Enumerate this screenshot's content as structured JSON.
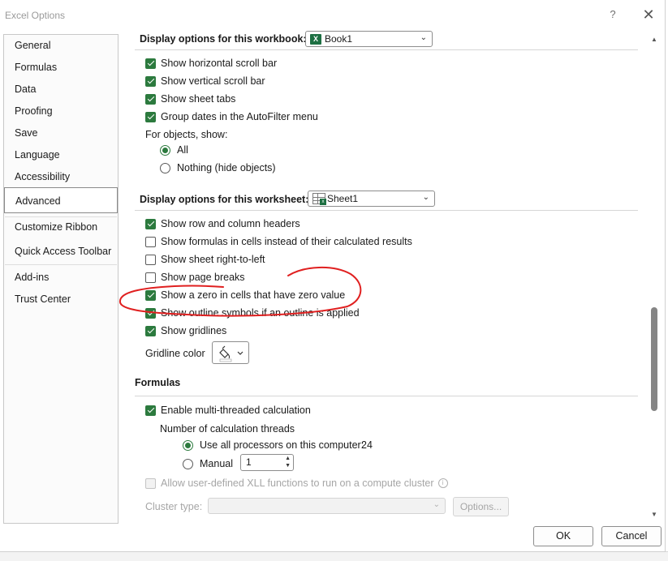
{
  "window": {
    "title": "Excel Options",
    "help": "?",
    "close": "✕"
  },
  "sidebar": {
    "items": [
      {
        "label": "General"
      },
      {
        "label": "Formulas"
      },
      {
        "label": "Data"
      },
      {
        "label": "Proofing"
      },
      {
        "label": "Save"
      },
      {
        "label": "Language"
      },
      {
        "label": "Accessibility"
      },
      {
        "label": "Advanced",
        "selected": true
      },
      {
        "label": "Customize Ribbon"
      },
      {
        "label": "Quick Access Toolbar"
      },
      {
        "label": "Add-ins"
      },
      {
        "label": "Trust Center"
      }
    ]
  },
  "workbook_section": {
    "heading": "Display options for this workbook:",
    "dropdown_value": "Book1",
    "options": [
      {
        "label": "Show horizontal scroll bar",
        "checked": true
      },
      {
        "label": "Show vertical scroll bar",
        "checked": true
      },
      {
        "label": "Show sheet tabs",
        "checked": true
      },
      {
        "label": "Group dates in the AutoFilter menu",
        "checked": true
      }
    ],
    "objects_label": "For objects, show:",
    "objects_all": "All",
    "objects_nothing": "Nothing (hide objects)"
  },
  "worksheet_section": {
    "heading": "Display options for this worksheet:",
    "dropdown_value": "Sheet1",
    "options": [
      {
        "label": "Show row and column headers",
        "checked": true
      },
      {
        "label": "Show formulas in cells instead of their calculated results",
        "checked": false
      },
      {
        "label": "Show sheet right-to-left",
        "checked": false
      },
      {
        "label": "Show page breaks",
        "checked": false
      },
      {
        "label": "Show a zero in cells that have zero value",
        "checked": true
      },
      {
        "label": "Show outline symbols if an outline is applied",
        "checked": true
      },
      {
        "label": "Show gridlines",
        "checked": true
      }
    ],
    "gridline_color_label": "Gridline color"
  },
  "formulas_section": {
    "heading": "Formulas",
    "multithread_label": "Enable multi-threaded calculation",
    "threads_label": "Number of calculation threads",
    "use_all_label": "Use all processors on this computer:",
    "use_all_value": "24",
    "manual_label": "Manual",
    "manual_value": "1",
    "xll_label": "Allow user-defined XLL functions to run on a compute cluster",
    "cluster_type_label": "Cluster type:",
    "options_button": "Options..."
  },
  "footer": {
    "ok": "OK",
    "cancel": "Cancel"
  },
  "colors": {
    "accent": "#2c7a3e",
    "annotation": "#e02020",
    "excel_green": "#1d6f42"
  }
}
